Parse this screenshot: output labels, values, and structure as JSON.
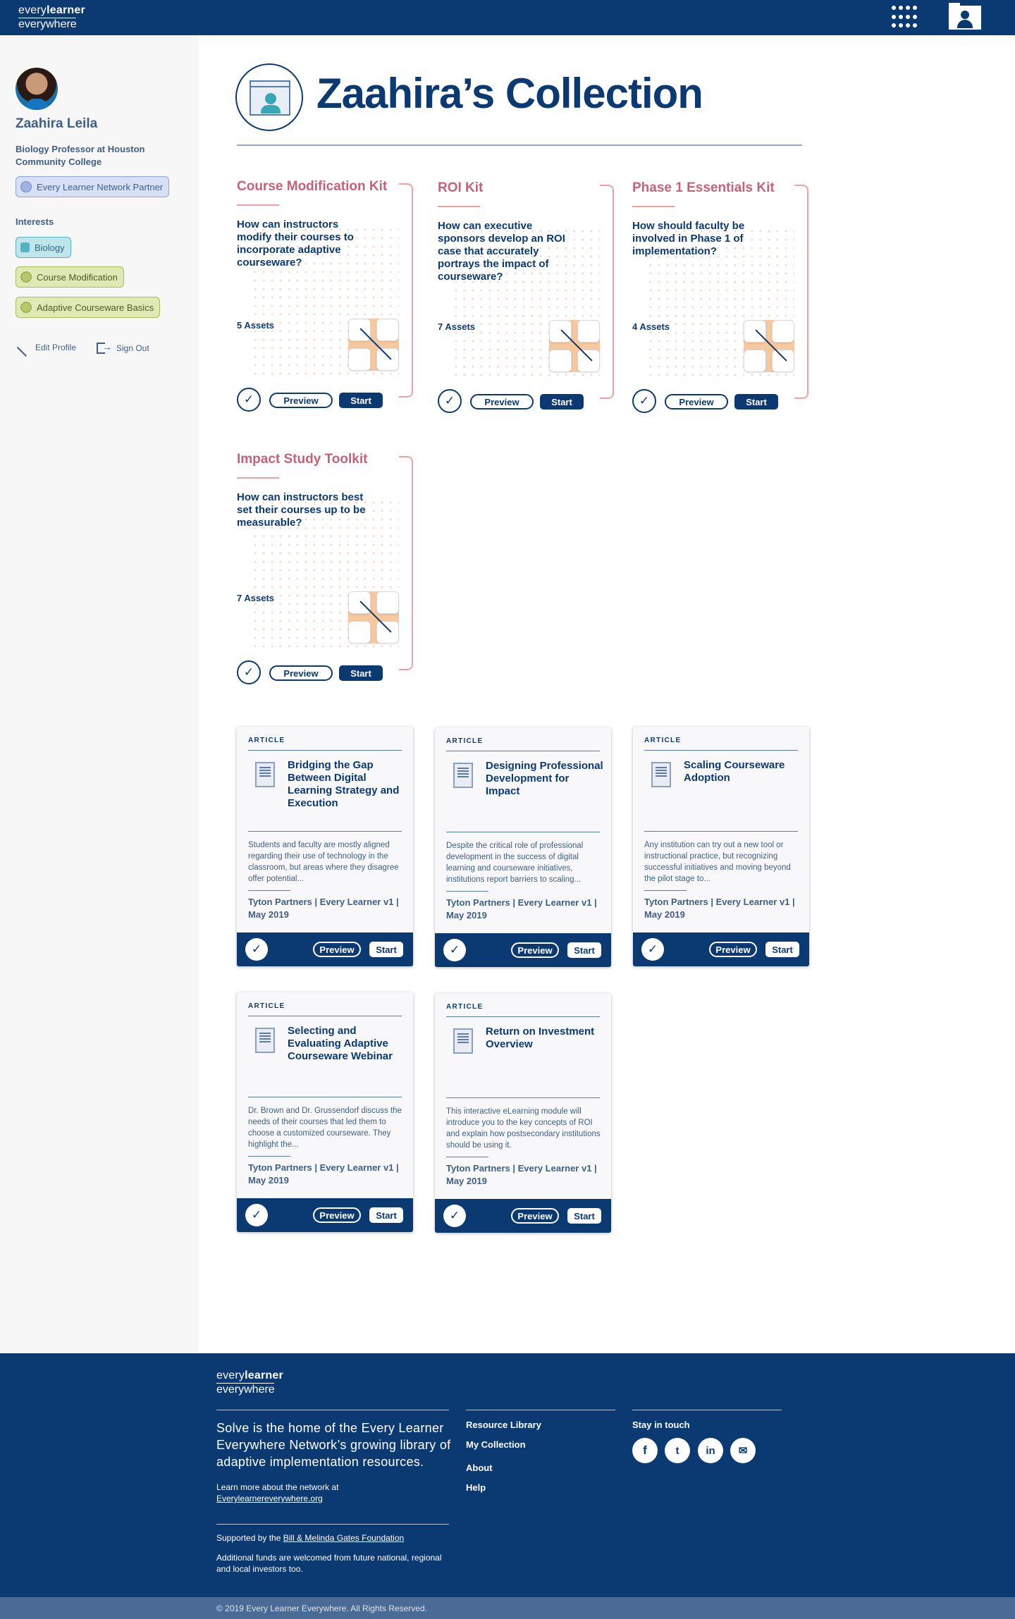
{
  "brand": {
    "line1_light": "every",
    "line1_bold": "learner",
    "line2": "everywhere"
  },
  "header": {
    "apps_icon": "apps-grid-icon",
    "profile_icon": "profile-card-icon"
  },
  "sidebar": {
    "name": "Zaahira Leila",
    "title": "Biology Professor at Houston Community College",
    "partner_badge": "Every Learner Network Partner",
    "interests_heading": "Interests",
    "interests": [
      "Biology",
      "Course Modification",
      "Adaptive Courseware Basics"
    ],
    "edit_profile": "Edit Profile",
    "sign_out": "Sign Out"
  },
  "page": {
    "title": "Zaahira’s Collection"
  },
  "kits": [
    {
      "title": "Course Modification Kit",
      "question": "How can instructors modify their courses to incorporate adaptive courseware?",
      "assets": "5 Assets",
      "preview": "Preview",
      "start": "Start"
    },
    {
      "title": "ROI Kit",
      "question": "How can executive sponsors develop an ROI case that accurately portrays the impact of courseware?",
      "assets": "7 Assets",
      "preview": "Preview",
      "start": "Start"
    },
    {
      "title": "Phase 1 Essentials Kit",
      "question": "How should faculty be involved in Phase 1 of implementation?",
      "assets": "4 Assets",
      "preview": "Preview",
      "start": "Start"
    },
    {
      "title": "Impact Study Toolkit",
      "question": "How can instructors best set their courses up to be measurable?",
      "assets": "7 Assets",
      "preview": "Preview",
      "start": "Start"
    }
  ],
  "articles": [
    {
      "tag": "ARTICLE",
      "title": "Bridging the Gap Between Digital Learning Strategy and Execution",
      "desc": "Students and faculty are mostly aligned regarding their use of technology in the classroom, but areas where they disagree offer potential...",
      "byline": "Tyton Partners | Every Learner v1 | May 2019",
      "preview": "Preview",
      "start": "Start"
    },
    {
      "tag": "ARTICLE",
      "title": "Designing Professional Development for Impact",
      "desc": "Despite the critical role of professional development in the success of digital learning and courseware initiatives, institutions report barriers to scaling...",
      "byline": "Tyton Partners | Every Learner v1 | May 2019",
      "preview": "Preview",
      "start": "Start"
    },
    {
      "tag": "ARTICLE",
      "title": "Scaling Courseware Adoption",
      "desc": "Any institution can try out a new tool or instructional practice, but recognizing successful initiatives and moving beyond the pilot stage to...",
      "byline": "Tyton Partners | Every Learner v1 | May 2019",
      "preview": "Preview",
      "start": "Start"
    },
    {
      "tag": "ARTICLE",
      "title": "Selecting and Evaluating Adaptive Courseware Webinar",
      "desc": "Dr. Brown and Dr. Grussendorf discuss the needs of their courses that led them to choose a customized courseware. They highlight the...",
      "byline": "Tyton Partners | Every Learner v1 | May 2019",
      "preview": "Preview",
      "start": "Start"
    },
    {
      "tag": "ARTICLE",
      "title": "Return on Investment Overview",
      "desc": "This interactive eLearning module will introduce you to the key concepts of ROI and explain how postsecondary institutions should be using it.",
      "byline": "Tyton Partners | Every Learner v1 | May 2019",
      "preview": "Preview",
      "start": "Start"
    }
  ],
  "footer": {
    "description": "Solve is the home of the Every Learner Everywhere Network’s growing library of adaptive implementation resources.",
    "learn_more": "Learn more about the network at",
    "learn_more_link": "Everylearnereverywhere.org",
    "supported_prefix": "Supported by the",
    "supported_link": "Bill & Melinda Gates Foundation",
    "additional_funds": "Additional funds are welcomed from future national, regional and local investors too.",
    "links": [
      "Resource Library",
      "My Collection",
      "About",
      "Help"
    ],
    "stay_in_touch": "Stay in touch",
    "social": [
      "facebook-icon",
      "twitter-icon",
      "linkedin-icon",
      "email-icon"
    ],
    "copyright": "© 2019 Every Learner Everywhere. All Rights Reserved."
  }
}
